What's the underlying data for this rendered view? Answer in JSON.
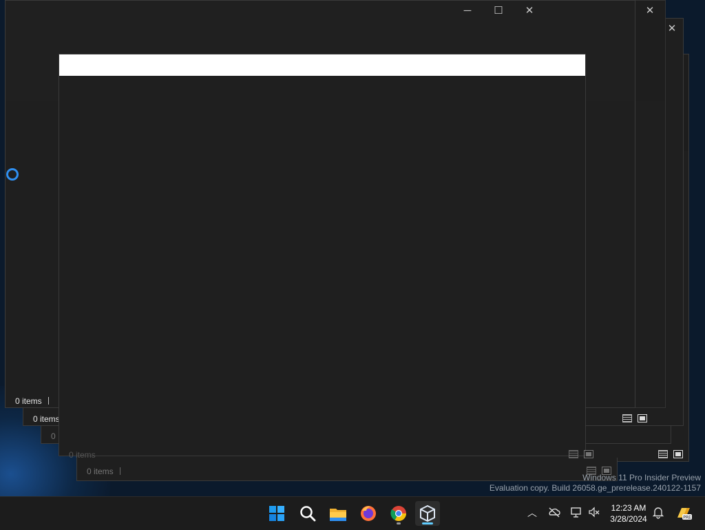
{
  "windows": [
    {
      "status": "0 items"
    },
    {
      "status": "0 items"
    },
    {
      "status": "0"
    },
    {
      "status": "0 items"
    },
    {
      "status": "0 items"
    }
  ],
  "front_window": {
    "title": ""
  },
  "watermark": {
    "line1": "Windows 11 Pro Insider Preview",
    "line2": "Evaluation copy. Build 26058.ge_prerelease.240122-1157"
  },
  "taskbar": {
    "apps": [
      {
        "icon": "windows-start-icon"
      },
      {
        "icon": "search-icon"
      },
      {
        "icon": "file-explorer-icon"
      },
      {
        "icon": "firefox-icon"
      },
      {
        "icon": "chrome-icon"
      },
      {
        "icon": "virtualbox-icon"
      }
    ],
    "clock": {
      "time": "12:23 AM",
      "date": "3/28/2024"
    },
    "colors": {
      "accent": "#60cdff",
      "start_blue": "#1e9bf0"
    }
  }
}
